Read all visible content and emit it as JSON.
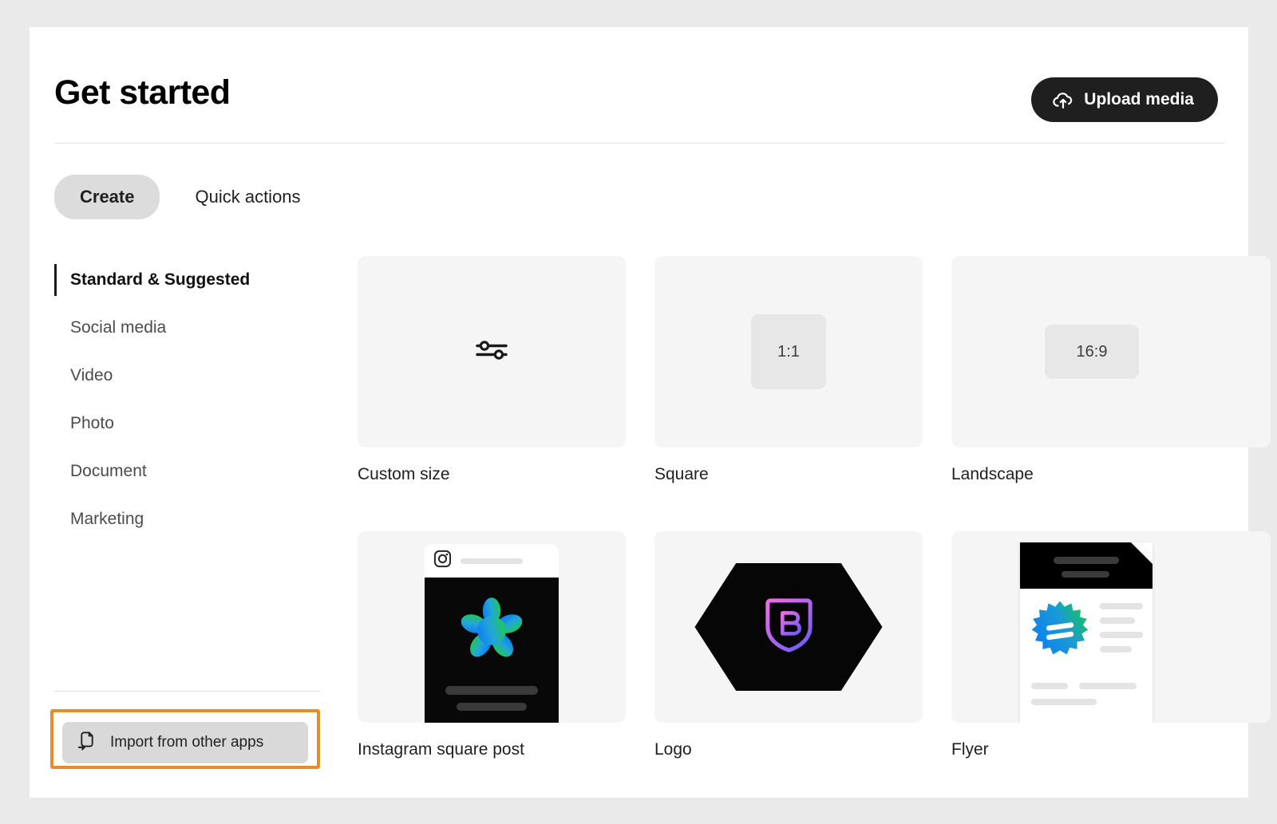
{
  "header": {
    "title": "Get started",
    "upload_label": "Upload media",
    "upload_icon": "cloud-upload-icon"
  },
  "tabs": [
    {
      "label": "Create",
      "active": true
    },
    {
      "label": "Quick actions",
      "active": false
    }
  ],
  "sidebar": {
    "items": [
      {
        "label": "Standard & Suggested",
        "active": true
      },
      {
        "label": "Social media",
        "active": false
      },
      {
        "label": "Video",
        "active": false
      },
      {
        "label": "Photo",
        "active": false
      },
      {
        "label": "Document",
        "active": false
      },
      {
        "label": "Marketing",
        "active": false
      }
    ],
    "import": {
      "label": "Import from other apps",
      "icon": "import-document-icon",
      "highlight_color": "#ec8b23"
    }
  },
  "cards": [
    {
      "label": "Custom size",
      "thumb": "sliders-icon",
      "ratio": ""
    },
    {
      "label": "Square",
      "thumb": "ratio-box",
      "ratio": "1:1"
    },
    {
      "label": "Landscape",
      "thumb": "ratio-box",
      "ratio": "16:9"
    },
    {
      "label": "Instagram square post",
      "thumb": "instagram-mock",
      "ratio": ""
    },
    {
      "label": "Logo",
      "thumb": "logo-mock",
      "ratio": ""
    },
    {
      "label": "Flyer",
      "thumb": "flyer-mock",
      "ratio": ""
    }
  ],
  "colors": {
    "accent_highlight": "#ec8b23",
    "upload_button_bg": "#1f1f1f",
    "tab_active_bg": "#dcdcdc",
    "thumb_bg": "#f5f5f5",
    "gradient_blue": "#0d7ff2",
    "gradient_green": "#1ec94f",
    "gradient_pink": "#e96de8",
    "gradient_purple": "#7b5cf5"
  }
}
